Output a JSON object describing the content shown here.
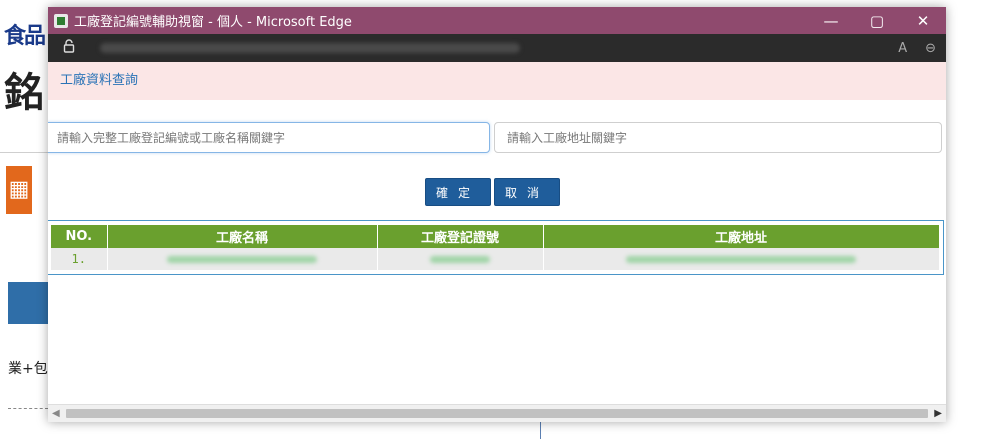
{
  "background": {
    "top_text": "食品",
    "logo_char": "銘",
    "orange_icon": "▦",
    "mid_text": "業+包"
  },
  "window": {
    "title": "工廠登記編號輔助視窗 - 個人 - Microsoft Edge",
    "controls": {
      "minimize": "—",
      "maximize": "▢",
      "close": "✕"
    },
    "addressbar": {
      "read_aloud": "A",
      "zoom": "⊖"
    }
  },
  "page": {
    "section_title": "工廠資料查詢",
    "search": {
      "factory_placeholder": "請輸入完整工廠登記編號或工廠名稱關鍵字",
      "address_placeholder": "請輸入工廠地址關鍵字"
    },
    "buttons": {
      "confirm": "確定",
      "cancel": "取消"
    },
    "table": {
      "headers": [
        "NO.",
        "工廠名稱",
        "工廠登記證號",
        "工廠地址"
      ],
      "rows": [
        {
          "no": "1."
        }
      ]
    }
  },
  "colors": {
    "titlebar": "#8f4a6e",
    "accent_blue": "#1f5d9b",
    "table_header": "#6aa02e"
  }
}
